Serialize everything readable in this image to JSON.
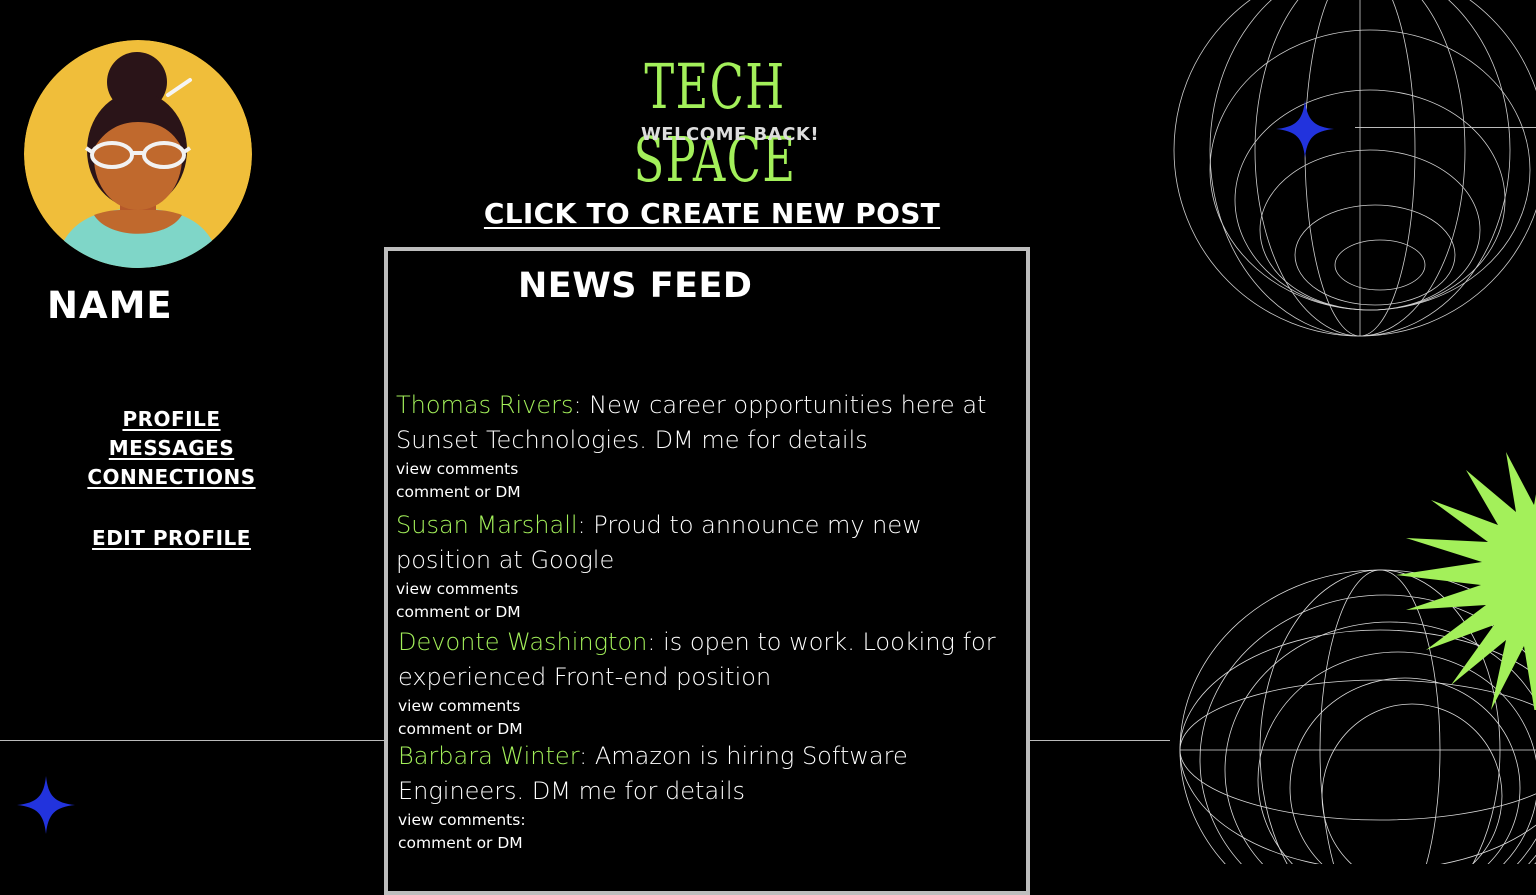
{
  "brand": {
    "title": "TECH SPACE",
    "subtitle": "WELCOME BACK!"
  },
  "profile": {
    "name": "NAME"
  },
  "nav": {
    "profile": "PROFILE",
    "messages": "MESSAGES",
    "connections": "CONNECTIONS",
    "edit_profile": "EDIT PROFILE"
  },
  "actions": {
    "create_post": "CLICK TO CREATE NEW POST"
  },
  "feed": {
    "title": "NEWS FEED",
    "posts": [
      {
        "author": "Thomas Rivers",
        "text": ": New career opportunities here at Sunset Technologies. DM me for details",
        "view_comments": "view comments",
        "comment": "comment or DM"
      },
      {
        "author": "Susan Marshall",
        "text": ":  Proud to announce my new position at Google",
        "view_comments": "view comments",
        "comment": "comment or DM"
      },
      {
        "author": "Devonte Washington",
        "text": ": is open to work. Looking for experienced Front-end position",
        "view_comments": "view comments",
        "comment": "comment or DM"
      },
      {
        "author": "Barbara Winter",
        "text": ": Amazon is hiring Software Engineers. DM me for details",
        "view_comments": "view comments:",
        "comment": "comment or DM"
      }
    ]
  },
  "colors": {
    "accent": "#a3f05a",
    "sparkle": "#2233dd",
    "avatar_bg": "#f0be3a",
    "feed_border": "#bdbdbd"
  },
  "icons": {
    "avatar": "woman-with-glasses-avatar",
    "sparkle": "four-point-star-icon",
    "starburst": "green-starburst-icon",
    "wireframe": "wireframe-sphere-icon"
  }
}
